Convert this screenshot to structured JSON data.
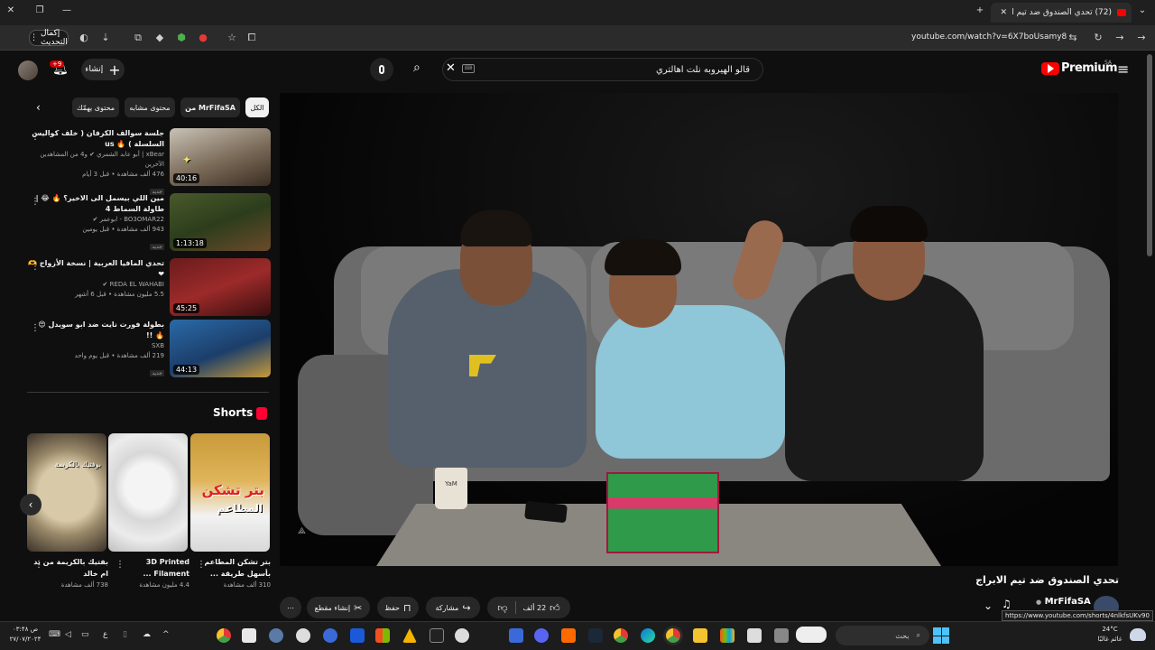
{
  "browser": {
    "tab_title": "(72) تحدي الصندوق ضد تيم الابرا...",
    "tab_count_badge": "",
    "url": "youtube.com/watch?v=6X7boUsamy8",
    "update_button": "إكمال التحديث"
  },
  "header": {
    "search_value": "قالو الهيروبه نلت اهالتري",
    "brand": "Premium",
    "brand_region": "SA",
    "create_label": "إنشاء",
    "notifications_count": "+9"
  },
  "chips": [
    "الكل",
    "من MrFifaSA",
    "محتوى مشابه",
    "محتوى يهمّك"
  ],
  "recommendations": [
    {
      "title": "جلسة سوالف الكرفان ( خلف كواليس السلسلة ) 🔥 us",
      "channel": "xBear | أبو عابد الشمري ✔ و4 من المشاهدين الآخرين",
      "views": "476 ألف مشاهدة • قبل 3 أيام",
      "badge": "جديد",
      "duration": "40:16"
    },
    {
      "title": "مين اللي بيسمل الى الاخير؟ 🔥 😂 | طاولة السماط 4",
      "channel": "BO3OMAR22 - ابوعمر ✔",
      "views": "943 ألف مشاهدة • قبل يومين",
      "badge": "جديد",
      "duration": "1:13:18"
    },
    {
      "title": "تحدي المافيا العربية | نسخة الأزواج 🫶 ❤",
      "channel": "REDA EL WAHABI ✔",
      "views": "5.5 مليون مشاهدة • قبل 6 أشهر",
      "badge": "",
      "duration": "45:25"
    },
    {
      "title": "بطولة فورت نايت ضد ابو سويدل 😍 🔥 !!",
      "channel": "SXB",
      "views": "219 ألف مشاهدة • قبل يوم واحد",
      "badge": "جديد",
      "duration": "44:13"
    }
  ],
  "shorts": {
    "heading": "Shorts",
    "items": [
      {
        "title": "بتر تشكن المطاعم بأسهل طريقة ...",
        "views": "310 ألف مشاهدة"
      },
      {
        "title": "3D Printed Filament ...",
        "views": "4.4 مليون مشاهدة"
      },
      {
        "title": "بفتيك بالكريمة من يد ام خالد",
        "views": "738 ألف مشاهدة"
      }
    ],
    "overlay_text_1": "بتر تشكن",
    "overlay_text_2": "المطاعم",
    "overlay_text_3": "بوفتيك بالكريمة"
  },
  "video": {
    "title": "تحدي الصندوق ضد تيم الابراج",
    "channel": "MrFifaSA",
    "likes": "22 ألف",
    "share_label": "مشاركة",
    "save_label": "حفظ",
    "clip_label": "إنشاء مقطع",
    "cup_text": "YaM"
  },
  "status_url": "https://www.youtube.com/shorts/4nlkfsUKv90",
  "taskbar": {
    "search_label": "بحث",
    "weather_temp": "24°C",
    "weather_desc": "غائم غالبًا",
    "time": "۰۳:۴۸ ص",
    "date": "۲۷/۰۷/۲۰۲۴",
    "lang": "ع"
  },
  "colors": {
    "youtube_red": "#ff0000",
    "background": "#0f0f0f"
  }
}
